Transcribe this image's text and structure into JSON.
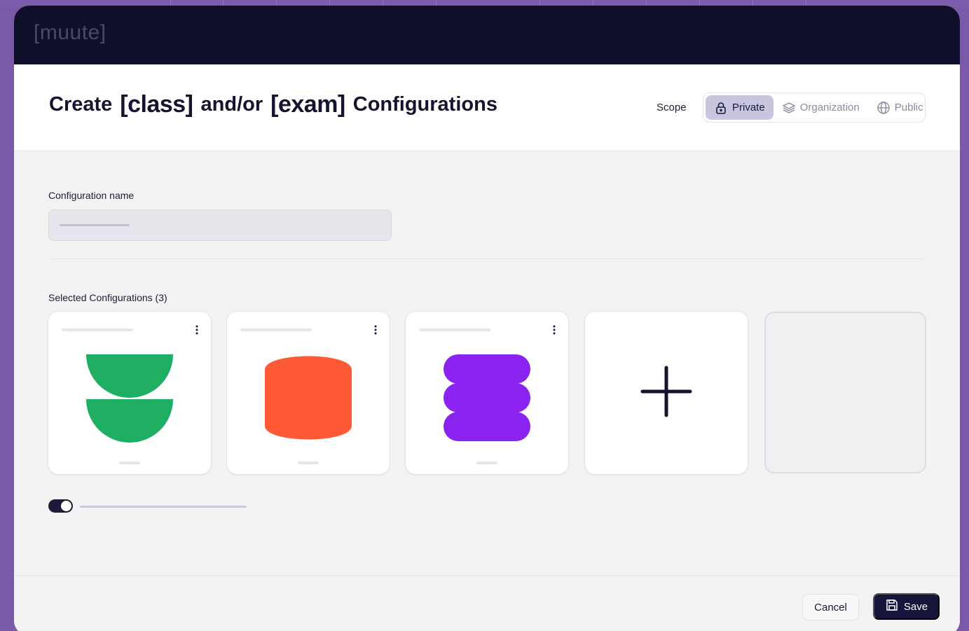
{
  "app": {
    "logo": "[muute]"
  },
  "header": {
    "title_prefix": "Create",
    "title_word1": "[class]",
    "title_middle": "and/or",
    "title_word2": "[exam]",
    "title_suffix": "Configurations",
    "scope_label": "Scope",
    "scope_options": [
      {
        "label": "Private",
        "icon": "lock-icon",
        "active": true
      },
      {
        "label": "Organization",
        "icon": "layers-icon",
        "active": false
      },
      {
        "label": "Public",
        "icon": "globe-icon",
        "active": false
      }
    ]
  },
  "form": {
    "name_label": "Configuration name",
    "name_value": "",
    "selected_label": "Selected Configurations (3)",
    "cards": [
      {
        "shape": "two-half-circles",
        "color": "#1eaf63"
      },
      {
        "shape": "rounded-barrel",
        "color": "#ff5a36"
      },
      {
        "shape": "stacked-pills",
        "color": "#8a22f0"
      }
    ],
    "add_card_icon": "plus-icon",
    "toggle_on": true
  },
  "footer": {
    "cancel_label": "Cancel",
    "save_label": "Save",
    "save_icon": "save-icon"
  },
  "colors": {
    "app_bar": "#0f0e2b",
    "frame": "#7a5aa8",
    "primary": "#16163d",
    "scope_active": "#c8c6de"
  }
}
